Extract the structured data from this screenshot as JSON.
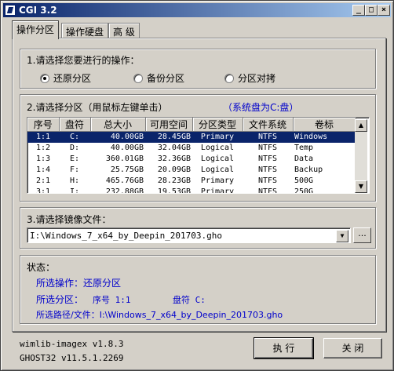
{
  "window": {
    "title": "CGI 3.2"
  },
  "tabs": [
    {
      "label": "操作分区"
    },
    {
      "label": "操作硬盘"
    },
    {
      "label": "高 级"
    }
  ],
  "operation": {
    "label": "1.请选择您要进行的操作：",
    "options": [
      {
        "label": "还原分区",
        "selected": true
      },
      {
        "label": "备份分区",
        "selected": false
      },
      {
        "label": "分区对拷",
        "selected": false
      }
    ]
  },
  "partition": {
    "label": "2.请选择分区（用鼠标左键单击）",
    "system_disk": "（系统盘为C:盘）",
    "columns": [
      "序号",
      "盘符",
      "总大小",
      "可用空间",
      "分区类型",
      "文件系统",
      "卷标"
    ],
    "rows": [
      [
        "1:1",
        "C:",
        "40.00GB",
        "28.45GB",
        "Primary",
        "NTFS",
        "Windows"
      ],
      [
        "1:2",
        "D:",
        "40.00GB",
        "32.04GB",
        "Logical",
        "NTFS",
        "Temp"
      ],
      [
        "1:3",
        "E:",
        "360.01GB",
        "32.36GB",
        "Logical",
        "NTFS",
        "Data"
      ],
      [
        "1:4",
        "F:",
        "25.75GB",
        "20.09GB",
        "Logical",
        "NTFS",
        "Backup"
      ],
      [
        "2:1",
        "H:",
        "465.76GB",
        "28.23GB",
        "Primary",
        "NTFS",
        "500G"
      ],
      [
        "3:1",
        "I:",
        "232.88GB",
        "19.53GB",
        "Primary",
        "NTFS",
        "250G"
      ]
    ],
    "selected_row": 0
  },
  "image": {
    "label": "3.请选择镜像文件：",
    "value": "I:\\Windows_7_x64_by_Deepin_201703.gho",
    "browse_label": "..."
  },
  "status": {
    "label": "状态：",
    "operation_line": "所选操作：还原分区",
    "partition_prefix": "所选分区：",
    "partition_index": "序号 1:1",
    "partition_drive": "盘符 C:",
    "path_line": "所选路径/文件：I:\\Windows_7_x64_by_Deepin_201703.gho"
  },
  "footer": {
    "wimlib": "wimlib-imagex v1.8.3",
    "ghost": "GHOST32 v11.5.1.2269",
    "execute_label": "执 行",
    "close_label": "关 闭"
  },
  "colors": {
    "selection": "#0a246a",
    "status_text": "#0000cc",
    "face": "#d4d0c8"
  }
}
